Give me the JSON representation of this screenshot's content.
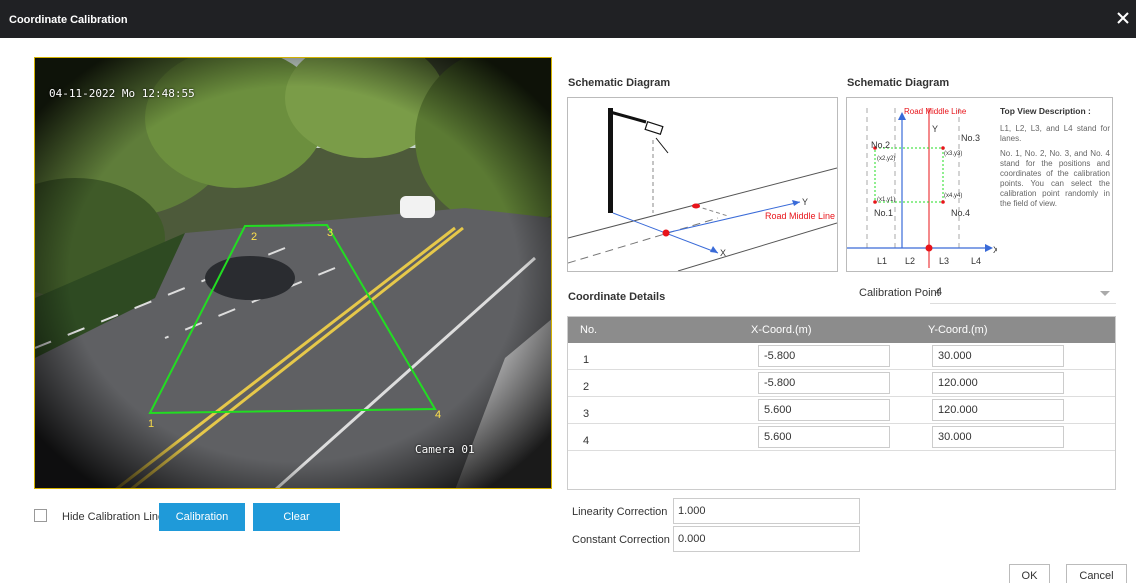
{
  "window": {
    "title": "Coordinate Calibration",
    "close_icon": "close-icon"
  },
  "camera": {
    "timestamp": "04-11-2022 Mo 12:48:55",
    "camera_name": "Camera 01",
    "points": [
      "1",
      "2",
      "3",
      "4"
    ]
  },
  "controls": {
    "hide_lines_label": "Hide Calibration Lines",
    "calibration_label": "Calibration",
    "clear_label": "Clear"
  },
  "schematic": {
    "title_left": "Schematic Diagram",
    "title_right": "Schematic Diagram",
    "road_middle_line": "Road Middle Line",
    "axis_x": "X",
    "axis_y": "Y",
    "top_view_labels": {
      "no1": "No.1",
      "no2": "No.2",
      "no3": "No.3",
      "no4": "No.4",
      "xy1": "(x1,y1)",
      "xy2": "(x2,y2)",
      "xy3": "(x3,y3)",
      "xy4": "(x4,y4)",
      "l1": "L1",
      "l2": "L2",
      "l3": "L3",
      "l4": "L4"
    },
    "description": {
      "heading": "Top View Description :",
      "p1": "L1, L2, L3, and L4 stand for lanes.",
      "p2": "No. 1, No. 2, No. 3, and No. 4 stand for the positions and coordinates of the calibration points. You can select the calibration point randomly in the field of view."
    }
  },
  "coordinate_details": {
    "title": "Coordinate Details",
    "calibration_point_label": "Calibration Point",
    "calibration_point_value": "4",
    "columns": [
      "No.",
      "X-Coord.(m)",
      "Y-Coord.(m)"
    ],
    "rows": [
      {
        "no": "1",
        "x": "-5.800",
        "y": "30.000"
      },
      {
        "no": "2",
        "x": "-5.800",
        "y": "120.000"
      },
      {
        "no": "3",
        "x": "5.600",
        "y": "120.000"
      },
      {
        "no": "4",
        "x": "5.600",
        "y": "30.000"
      }
    ]
  },
  "correction": {
    "linearity_label": "Linearity Correction",
    "linearity_value": "1.000",
    "constant_label": "Constant Correction",
    "constant_value": "0.000"
  },
  "footer": {
    "ok_label": "OK",
    "cancel_label": "Cancel"
  },
  "colors": {
    "titlebar": "#202124",
    "accent": "#1f9ad9",
    "calibration_line": "#22dd22",
    "road_middle_line": "#e8141a"
  }
}
